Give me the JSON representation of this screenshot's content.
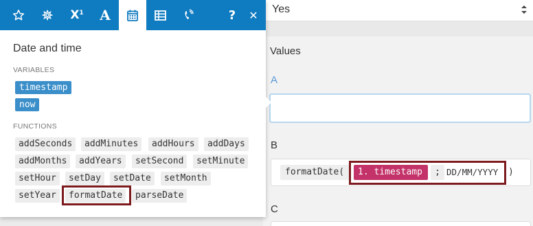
{
  "background_form": {
    "select_value": "Yes",
    "values_title": "Values",
    "field_a": {
      "label": "A",
      "value": ""
    },
    "field_b": {
      "label": "B",
      "function_name": "formatDate(",
      "variable": "1. timestamp",
      "separator": ";",
      "format_text": "DD/MM/YYYY",
      "closing_paren": ")"
    },
    "field_c": {
      "label": "C"
    }
  },
  "popup": {
    "toolbar": {
      "icons": [
        "star-icon",
        "gear-icon",
        "superscript-x-icon",
        "text-a-icon",
        "calendar-icon",
        "table-icon",
        "phone-icon",
        "help-icon",
        "close-icon"
      ],
      "active": "calendar-icon",
      "x_label": "X",
      "x_sup": "1",
      "a_label": "A",
      "help_label": "?",
      "close_label": "✕"
    },
    "title": "Date and time",
    "variables_heading": "VARIABLES",
    "variables": [
      "timestamp",
      "now"
    ],
    "functions_heading": "FUNCTIONS",
    "functions": [
      [
        "addSeconds",
        "addMinutes",
        "addHours",
        "addDays"
      ],
      [
        "addMonths",
        "addYears",
        "setSecond",
        "setMinute"
      ],
      [
        "setHour",
        "setDay",
        "setDate",
        "setMonth"
      ],
      [
        "setYear",
        "formatDate",
        "parseDate"
      ]
    ]
  },
  "colors": {
    "toolbar_blue": "#0f7bc0",
    "variable_chip": "#3a8ec9",
    "variable_pill_in_field": "#c33268",
    "highlight_box": "#7d1a1e",
    "label_a_blue": "#5b9bd5"
  }
}
